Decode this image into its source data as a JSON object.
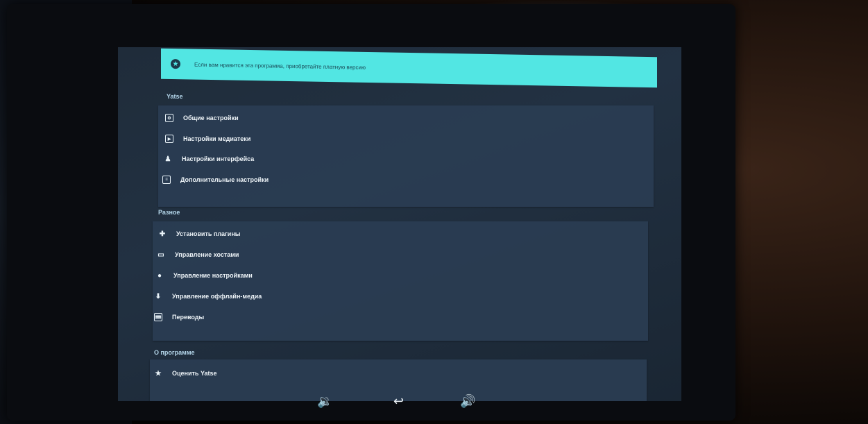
{
  "banner": {
    "text": "Если вам нравится эта программа, приобретайте платную версию"
  },
  "sections": [
    {
      "title": "Yatse",
      "items": [
        {
          "label": "Общие настройки",
          "icon": "settings-icon"
        },
        {
          "label": "Настройки медиатеки",
          "icon": "library-icon"
        },
        {
          "label": "Настройки интерфейса",
          "icon": "person-icon"
        },
        {
          "label": "Дополнительные настройки",
          "icon": "advanced-icon"
        }
      ]
    },
    {
      "title": "Разное",
      "items": [
        {
          "label": "Установить плагины",
          "icon": "puzzle-icon"
        },
        {
          "label": "Управление хостами",
          "icon": "hosts-icon"
        },
        {
          "label": "Управление настройками",
          "icon": "cloud-icon"
        },
        {
          "label": "Управление оффлайн-медиа",
          "icon": "download-icon"
        },
        {
          "label": "Переводы",
          "icon": "keyboard-icon"
        }
      ]
    },
    {
      "title": "О программе",
      "items": [
        {
          "label": "Оценить Yatse",
          "icon": "star-icon"
        }
      ]
    }
  ],
  "navbar": {
    "volume_down_icon": "volume-down-icon",
    "back_icon": "back-icon",
    "volume_up_icon": "volume-up-icon"
  },
  "colors": {
    "accent": "#52e6e3",
    "background": "#1f2c3a",
    "card": "#2a3d52",
    "section_title": "#b4d6ea"
  }
}
